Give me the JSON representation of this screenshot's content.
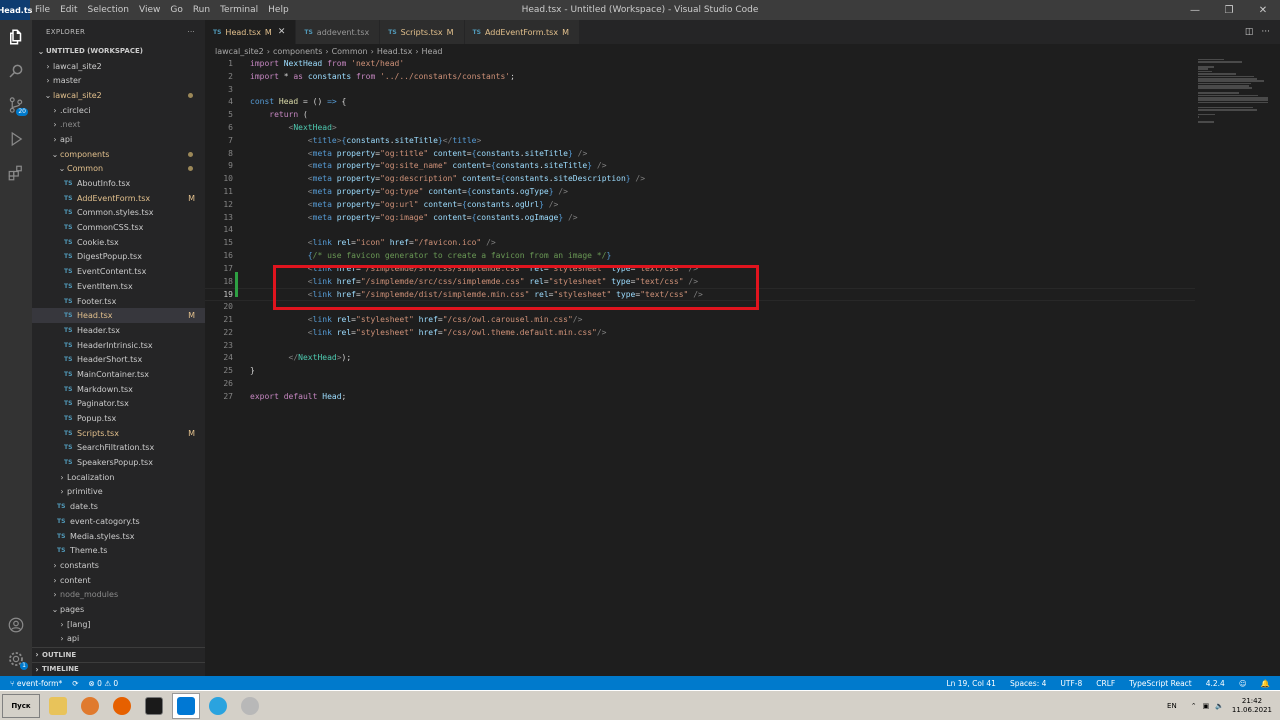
{
  "app": {
    "logo_text": "Head.ts",
    "window_title": "Head.tsx - Untitled (Workspace) - Visual Studio Code"
  },
  "menu": [
    "File",
    "Edit",
    "Selection",
    "View",
    "Go",
    "Run",
    "Terminal",
    "Help"
  ],
  "activity": {
    "scm_badge": "20",
    "accounts_badge": "1"
  },
  "sidebar": {
    "header": "EXPLORER",
    "workspace": "UNTITLED (WORKSPACE)",
    "items": [
      {
        "label": "lawcal_site2",
        "indent": 1,
        "chev": "›",
        "kind": "folder"
      },
      {
        "label": "master",
        "indent": 1,
        "chev": "›",
        "kind": "folder"
      },
      {
        "label": "lawcal_site2",
        "indent": 1,
        "chev": "⌄",
        "kind": "folder",
        "mod": "dot",
        "cls": "modified"
      },
      {
        "label": ".circleci",
        "indent": 2,
        "chev": "›",
        "kind": "folder"
      },
      {
        "label": ".next",
        "indent": 2,
        "chev": "›",
        "kind": "folder",
        "cls": "dim"
      },
      {
        "label": "api",
        "indent": 2,
        "chev": "›",
        "kind": "folder"
      },
      {
        "label": "components",
        "indent": 2,
        "chev": "⌄",
        "kind": "folder",
        "mod": "dot",
        "cls": "modified"
      },
      {
        "label": "Common",
        "indent": 3,
        "chev": "⌄",
        "kind": "folder",
        "mod": "dot",
        "cls": "modified"
      },
      {
        "label": "AboutInfo.tsx",
        "indent": 4,
        "kind": "ts"
      },
      {
        "label": "AddEventForm.tsx",
        "indent": 4,
        "kind": "ts",
        "mod": "M",
        "cls": "modified"
      },
      {
        "label": "Common.styles.tsx",
        "indent": 4,
        "kind": "ts"
      },
      {
        "label": "CommonCSS.tsx",
        "indent": 4,
        "kind": "ts"
      },
      {
        "label": "Cookie.tsx",
        "indent": 4,
        "kind": "ts"
      },
      {
        "label": "DigestPopup.tsx",
        "indent": 4,
        "kind": "ts"
      },
      {
        "label": "EventContent.tsx",
        "indent": 4,
        "kind": "ts"
      },
      {
        "label": "EventItem.tsx",
        "indent": 4,
        "kind": "ts"
      },
      {
        "label": "Footer.tsx",
        "indent": 4,
        "kind": "ts"
      },
      {
        "label": "Head.tsx",
        "indent": 4,
        "kind": "ts",
        "mod": "M",
        "cls": "modified",
        "active": true
      },
      {
        "label": "Header.tsx",
        "indent": 4,
        "kind": "ts"
      },
      {
        "label": "HeaderIntrinsic.tsx",
        "indent": 4,
        "kind": "ts"
      },
      {
        "label": "HeaderShort.tsx",
        "indent": 4,
        "kind": "ts"
      },
      {
        "label": "MainContainer.tsx",
        "indent": 4,
        "kind": "ts"
      },
      {
        "label": "Markdown.tsx",
        "indent": 4,
        "kind": "ts"
      },
      {
        "label": "Paginator.tsx",
        "indent": 4,
        "kind": "ts"
      },
      {
        "label": "Popup.tsx",
        "indent": 4,
        "kind": "ts"
      },
      {
        "label": "Scripts.tsx",
        "indent": 4,
        "kind": "ts",
        "mod": "M",
        "cls": "modified"
      },
      {
        "label": "SearchFiltration.tsx",
        "indent": 4,
        "kind": "ts"
      },
      {
        "label": "SpeakersPopup.tsx",
        "indent": 4,
        "kind": "ts"
      },
      {
        "label": "Localization",
        "indent": 3,
        "chev": "›",
        "kind": "folder"
      },
      {
        "label": "primitive",
        "indent": 3,
        "chev": "›",
        "kind": "folder"
      },
      {
        "label": "date.ts",
        "indent": 3,
        "kind": "ts"
      },
      {
        "label": "event-catogory.ts",
        "indent": 3,
        "kind": "ts"
      },
      {
        "label": "Media.styles.tsx",
        "indent": 3,
        "kind": "ts"
      },
      {
        "label": "Theme.ts",
        "indent": 3,
        "kind": "ts"
      },
      {
        "label": "constants",
        "indent": 2,
        "chev": "›",
        "kind": "folder"
      },
      {
        "label": "content",
        "indent": 2,
        "chev": "›",
        "kind": "folder"
      },
      {
        "label": "node_modules",
        "indent": 2,
        "chev": "›",
        "kind": "folder",
        "cls": "dim"
      },
      {
        "label": "pages",
        "indent": 2,
        "chev": "⌄",
        "kind": "folder"
      },
      {
        "label": "[lang]",
        "indent": 3,
        "chev": "›",
        "kind": "folder"
      },
      {
        "label": "api",
        "indent": 3,
        "chev": "›",
        "kind": "folder"
      }
    ],
    "outline": "OUTLINE",
    "timeline": "TIMELINE"
  },
  "tabs": [
    {
      "label": "Head.tsx",
      "flag": "M",
      "active": true
    },
    {
      "label": "addevent.tsx",
      "flag": "",
      "active": false
    },
    {
      "label": "Scripts.tsx",
      "flag": "M",
      "active": false,
      "modified": true
    },
    {
      "label": "AddEventForm.tsx",
      "flag": "M",
      "active": false,
      "modified": true
    }
  ],
  "breadcrumb": [
    "lawcal_site2",
    "components",
    "Common",
    "Head.tsx",
    "Head"
  ],
  "code": {
    "current_line": 19,
    "lines": [
      [
        [
          "kf",
          "import "
        ],
        [
          "v",
          "NextHead"
        ],
        [
          "kf",
          " from "
        ],
        [
          "s",
          "'next/head'"
        ]
      ],
      [
        [
          "kf",
          "import "
        ],
        [
          "p",
          "* "
        ],
        [
          "kf",
          "as "
        ],
        [
          "v",
          "constants"
        ],
        [
          "kf",
          " from "
        ],
        [
          "s",
          "'../../constants/constants'"
        ],
        [
          "p",
          ";"
        ]
      ],
      [],
      [
        [
          "k",
          "const "
        ],
        [
          "fn",
          "Head"
        ],
        [
          "p",
          " = () "
        ],
        [
          "k",
          "=>"
        ],
        [
          "p",
          " {"
        ]
      ],
      [
        [
          "p",
          "    "
        ],
        [
          "kf",
          "return"
        ],
        [
          "p",
          " ("
        ]
      ],
      [
        [
          "p",
          "        "
        ],
        [
          "tg",
          "<"
        ],
        [
          "t",
          "NextHead"
        ],
        [
          "tg",
          ">"
        ]
      ],
      [
        [
          "p",
          "            "
        ],
        [
          "tg",
          "<"
        ],
        [
          "k",
          "title"
        ],
        [
          "tg",
          ">"
        ],
        [
          "br",
          "{"
        ],
        [
          "v",
          "constants"
        ],
        [
          "p",
          "."
        ],
        [
          "v",
          "siteTitle"
        ],
        [
          "br",
          "}"
        ],
        [
          "tg",
          "</"
        ],
        [
          "k",
          "title"
        ],
        [
          "tg",
          ">"
        ]
      ],
      [
        [
          "p",
          "            "
        ],
        [
          "tg",
          "<"
        ],
        [
          "k",
          "meta "
        ],
        [
          "a",
          "property"
        ],
        [
          "p",
          "="
        ],
        [
          "s",
          "\"og:title\" "
        ],
        [
          "a",
          "content"
        ],
        [
          "p",
          "="
        ],
        [
          "br",
          "{"
        ],
        [
          "v",
          "constants"
        ],
        [
          "p",
          "."
        ],
        [
          "v",
          "siteTitle"
        ],
        [
          "br",
          "}"
        ],
        [
          "tg",
          " />"
        ]
      ],
      [
        [
          "p",
          "            "
        ],
        [
          "tg",
          "<"
        ],
        [
          "k",
          "meta "
        ],
        [
          "a",
          "property"
        ],
        [
          "p",
          "="
        ],
        [
          "s",
          "\"og:site_name\" "
        ],
        [
          "a",
          "content"
        ],
        [
          "p",
          "="
        ],
        [
          "br",
          "{"
        ],
        [
          "v",
          "constants"
        ],
        [
          "p",
          "."
        ],
        [
          "v",
          "siteTitle"
        ],
        [
          "br",
          "}"
        ],
        [
          "tg",
          " />"
        ]
      ],
      [
        [
          "p",
          "            "
        ],
        [
          "tg",
          "<"
        ],
        [
          "k",
          "meta "
        ],
        [
          "a",
          "property"
        ],
        [
          "p",
          "="
        ],
        [
          "s",
          "\"og:description\" "
        ],
        [
          "a",
          "content"
        ],
        [
          "p",
          "="
        ],
        [
          "br",
          "{"
        ],
        [
          "v",
          "constants"
        ],
        [
          "p",
          "."
        ],
        [
          "v",
          "siteDescription"
        ],
        [
          "br",
          "}"
        ],
        [
          "tg",
          " />"
        ]
      ],
      [
        [
          "p",
          "            "
        ],
        [
          "tg",
          "<"
        ],
        [
          "k",
          "meta "
        ],
        [
          "a",
          "property"
        ],
        [
          "p",
          "="
        ],
        [
          "s",
          "\"og:type\" "
        ],
        [
          "a",
          "content"
        ],
        [
          "p",
          "="
        ],
        [
          "br",
          "{"
        ],
        [
          "v",
          "constants"
        ],
        [
          "p",
          "."
        ],
        [
          "v",
          "ogType"
        ],
        [
          "br",
          "}"
        ],
        [
          "tg",
          " />"
        ]
      ],
      [
        [
          "p",
          "            "
        ],
        [
          "tg",
          "<"
        ],
        [
          "k",
          "meta "
        ],
        [
          "a",
          "property"
        ],
        [
          "p",
          "="
        ],
        [
          "s",
          "\"og:url\" "
        ],
        [
          "a",
          "content"
        ],
        [
          "p",
          "="
        ],
        [
          "br",
          "{"
        ],
        [
          "v",
          "constants"
        ],
        [
          "p",
          "."
        ],
        [
          "v",
          "ogUrl"
        ],
        [
          "br",
          "}"
        ],
        [
          "tg",
          " />"
        ]
      ],
      [
        [
          "p",
          "            "
        ],
        [
          "tg",
          "<"
        ],
        [
          "k",
          "meta "
        ],
        [
          "a",
          "property"
        ],
        [
          "p",
          "="
        ],
        [
          "s",
          "\"og:image\" "
        ],
        [
          "a",
          "content"
        ],
        [
          "p",
          "="
        ],
        [
          "br",
          "{"
        ],
        [
          "v",
          "constants"
        ],
        [
          "p",
          "."
        ],
        [
          "v",
          "ogImage"
        ],
        [
          "br",
          "}"
        ],
        [
          "tg",
          " />"
        ]
      ],
      [],
      [
        [
          "p",
          "            "
        ],
        [
          "tg",
          "<"
        ],
        [
          "k",
          "link "
        ],
        [
          "a",
          "rel"
        ],
        [
          "p",
          "="
        ],
        [
          "s",
          "\"icon\" "
        ],
        [
          "a",
          "href"
        ],
        [
          "p",
          "="
        ],
        [
          "s",
          "\"/favicon.ico\""
        ],
        [
          "tg",
          " />"
        ]
      ],
      [
        [
          "p",
          "            "
        ],
        [
          "br",
          "{"
        ],
        [
          "c",
          "/* use favicon generator to create a favicon from an image */"
        ],
        [
          "br",
          "}"
        ]
      ],
      [
        [
          "p",
          "            "
        ],
        [
          "tg",
          "<"
        ],
        [
          "k",
          "link "
        ],
        [
          "a",
          "href"
        ],
        [
          "p",
          "="
        ],
        [
          "s",
          "\"/simplemde/src/css/simplemde.css\" "
        ],
        [
          "a",
          "rel"
        ],
        [
          "p",
          "="
        ],
        [
          "s",
          "\"stylesheet\" "
        ],
        [
          "a",
          "type"
        ],
        [
          "p",
          "="
        ],
        [
          "s",
          "\"text/css\""
        ],
        [
          "tg",
          " />"
        ]
      ],
      [
        [
          "p",
          "            "
        ],
        [
          "tg",
          "<"
        ],
        [
          "k",
          "link "
        ],
        [
          "a",
          "href"
        ],
        [
          "p",
          "="
        ],
        [
          "s",
          "\"/simplemde/src/css/simplemde.css\" "
        ],
        [
          "a",
          "rel"
        ],
        [
          "p",
          "="
        ],
        [
          "s",
          "\"stylesheet\" "
        ],
        [
          "a",
          "type"
        ],
        [
          "p",
          "="
        ],
        [
          "s",
          "\"text/css\""
        ],
        [
          "tg",
          " />"
        ]
      ],
      [
        [
          "p",
          "            "
        ],
        [
          "tg",
          "<"
        ],
        [
          "k",
          "link "
        ],
        [
          "a",
          "href"
        ],
        [
          "p",
          "="
        ],
        [
          "s",
          "\"/simplemde/dist/simplemde.min.css\" "
        ],
        [
          "a",
          "rel"
        ],
        [
          "p",
          "="
        ],
        [
          "s",
          "\"stylesheet\" "
        ],
        [
          "a",
          "type"
        ],
        [
          "p",
          "="
        ],
        [
          "s",
          "\"text/css\""
        ],
        [
          "tg",
          " />"
        ]
      ],
      [],
      [
        [
          "p",
          "            "
        ],
        [
          "tg",
          "<"
        ],
        [
          "k",
          "link "
        ],
        [
          "a",
          "rel"
        ],
        [
          "p",
          "="
        ],
        [
          "s",
          "\"stylesheet\" "
        ],
        [
          "a",
          "href"
        ],
        [
          "p",
          "="
        ],
        [
          "s",
          "\"/css/owl.carousel.min.css\""
        ],
        [
          "tg",
          "/>"
        ]
      ],
      [
        [
          "p",
          "            "
        ],
        [
          "tg",
          "<"
        ],
        [
          "k",
          "link "
        ],
        [
          "a",
          "rel"
        ],
        [
          "p",
          "="
        ],
        [
          "s",
          "\"stylesheet\" "
        ],
        [
          "a",
          "href"
        ],
        [
          "p",
          "="
        ],
        [
          "s",
          "\"/css/owl.theme.default.min.css\""
        ],
        [
          "tg",
          "/>"
        ]
      ],
      [],
      [
        [
          "p",
          "        "
        ],
        [
          "tg",
          "</"
        ],
        [
          "t",
          "NextHead"
        ],
        [
          "tg",
          ">"
        ],
        [
          "p",
          ");"
        ]
      ],
      [
        [
          "p",
          "}"
        ]
      ],
      [],
      [
        [
          "kf",
          "export "
        ],
        [
          "kf",
          "default "
        ],
        [
          "v",
          "Head"
        ],
        [
          "p",
          ";"
        ]
      ]
    ]
  },
  "status": {
    "branch": "event-form*",
    "problems": "⊗ 0 ⚠ 0",
    "position": "Ln 19, Col 41",
    "spaces": "Spaces: 4",
    "encoding": "UTF-8",
    "eol": "CRLF",
    "language": "TypeScript React",
    "version": "4.2.4"
  },
  "taskbar": {
    "start": "Пуск",
    "lang": "EN",
    "time": "21:42",
    "date": "11.06.2021"
  }
}
